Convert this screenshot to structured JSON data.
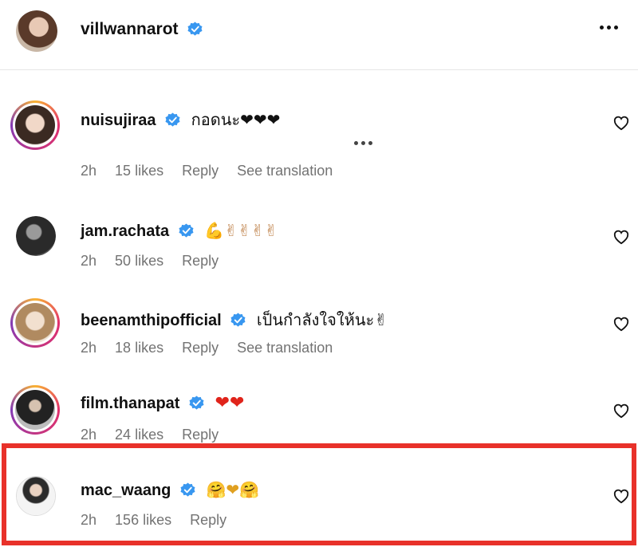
{
  "post_header": {
    "username": "villwannarot",
    "verified": true,
    "more_icon": "more-horizontal-icon"
  },
  "comments": [
    {
      "username": "nuisujiraa",
      "verified": true,
      "text": "กอดนะ❤❤❤",
      "time": "2h",
      "likes": "15 likes",
      "reply": "Reply",
      "translate": "See translation",
      "has_story_ring": true
    },
    {
      "username": "jam.rachata",
      "verified": true,
      "text": "💪✌✌✌✌",
      "time": "2h",
      "likes": "50 likes",
      "reply": "Reply",
      "has_story_ring": false
    },
    {
      "username": "beenamthipofficial",
      "verified": true,
      "text": "เป็นกำลังใจให้นะ✌",
      "time": "2h",
      "likes": "18 likes",
      "reply": "Reply",
      "translate": "See translation",
      "has_story_ring": true
    },
    {
      "username": "film.thanapat",
      "verified": true,
      "text": "❤❤",
      "time": "2h",
      "likes": "24 likes",
      "reply": "Reply",
      "has_story_ring": true
    },
    {
      "username": "mac_waang",
      "verified": true,
      "text": "🤗❤🤗",
      "time": "2h",
      "likes": "156 likes",
      "reply": "Reply",
      "has_story_ring": false,
      "highlighted": true
    }
  ],
  "colors": {
    "verified_blue": "#3897f0",
    "highlight_red": "#e8312a",
    "meta_gray": "#737373"
  }
}
